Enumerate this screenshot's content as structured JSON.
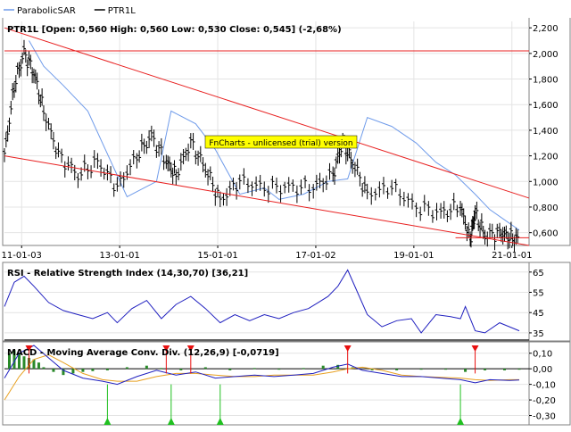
{
  "legend": {
    "items": [
      {
        "label": "ParabolicSAR",
        "color": "#6f9bea"
      },
      {
        "label": "PTR1L",
        "color": "#000000"
      }
    ]
  },
  "watermark": "FnCharts - unlicensed (trial) version",
  "colors": {
    "price": "#000000",
    "sar": "#6f9bea",
    "channel": "#e82020",
    "rsi": "#1f1fbf",
    "macd": "#1f1fbf",
    "signal": "#e8a020",
    "histogram": "#2a8a2a",
    "sell_arrow": "#e81010",
    "buy_arrow": "#20c020",
    "watermark_bg": "#ffff00"
  },
  "chart_data": [
    {
      "type": "line",
      "panel": "price",
      "title": "PTR1L [Open: 0,560  High: 0,560  Low: 0,530  Close: 0,545] (-2,68%)",
      "x": [
        "11-01-03",
        "13-01-01",
        "15-01-01",
        "17-01-02",
        "19-01-01",
        "21-01-01"
      ],
      "y_ticks": [
        "2,200",
        "2,000",
        "1,800",
        "1,600",
        "1,400",
        "1,200",
        "1,000",
        "0,800",
        "0,600"
      ],
      "y_tick_values": [
        2.2,
        2.0,
        1.8,
        1.6,
        1.4,
        1.2,
        1.0,
        0.8,
        0.6
      ],
      "ylim": [
        0.5,
        2.25
      ],
      "xlim": [
        2010.7,
        2021.4
      ],
      "series": [
        {
          "name": "PTR1L",
          "x": [
            2010.7,
            2010.9,
            2011.1,
            2011.3,
            2011.5,
            2011.8,
            2012.2,
            2012.6,
            2013.0,
            2013.4,
            2013.7,
            2014.0,
            2014.2,
            2014.5,
            2014.8,
            2015.1,
            2015.5,
            2016.0,
            2016.5,
            2017.0,
            2017.4,
            2017.6,
            2017.8,
            2018.1,
            2018.6,
            2019.1,
            2019.6,
            2020.0,
            2020.2,
            2020.3,
            2020.5,
            2020.8,
            2021.0,
            2021.2
          ],
          "values": [
            1.2,
            1.75,
            2.0,
            1.85,
            1.55,
            1.2,
            1.05,
            1.15,
            0.95,
            1.2,
            1.35,
            1.15,
            1.05,
            1.3,
            1.1,
            0.85,
            1.0,
            0.95,
            0.95,
            0.95,
            1.05,
            1.3,
            1.15,
            0.9,
            0.95,
            0.8,
            0.75,
            0.8,
            0.55,
            0.75,
            0.57,
            0.6,
            0.56,
            0.545
          ]
        },
        {
          "name": "ParabolicSAR",
          "x": [
            2011.2,
            2011.5,
            2011.9,
            2012.4,
            2013.2,
            2013.8,
            2014.1,
            2014.6,
            2015.0,
            2015.5,
            2016.0,
            2016.3,
            2016.8,
            2017.3,
            2017.7,
            2018.1,
            2018.6,
            2019.1,
            2019.5,
            2019.9,
            2020.3,
            2020.6,
            2020.9,
            2021.2
          ],
          "values": [
            2.1,
            1.9,
            1.75,
            1.55,
            0.88,
            1.0,
            1.55,
            1.45,
            1.25,
            0.9,
            0.95,
            0.86,
            0.9,
            1.0,
            1.02,
            1.5,
            1.43,
            1.3,
            1.15,
            1.05,
            0.9,
            0.78,
            0.7,
            0.62
          ]
        }
      ],
      "horizontal_lines": [
        2.02,
        0.56
      ],
      "channel_lines": [
        {
          "x": [
            2010.7,
            2021.4
          ],
          "values": [
            2.2,
            0.87
          ]
        },
        {
          "x": [
            2010.7,
            2021.4
          ],
          "values": [
            1.2,
            0.5
          ]
        }
      ],
      "grid": true
    },
    {
      "type": "line",
      "panel": "rsi",
      "title": "RSI - Relative Strength Index (14,30,70) [36,21]",
      "y_ticks": [
        "65",
        "55",
        "45",
        "35"
      ],
      "y_tick_values": [
        65,
        55,
        45,
        35
      ],
      "ylim": [
        31,
        68
      ],
      "xlim": [
        2010.7,
        2021.4
      ],
      "series": [
        {
          "name": "RSI",
          "x": [
            2010.7,
            2010.9,
            2011.1,
            2011.3,
            2011.6,
            2011.9,
            2012.2,
            2012.5,
            2012.8,
            2013.0,
            2013.3,
            2013.6,
            2013.9,
            2014.2,
            2014.5,
            2014.8,
            2015.1,
            2015.4,
            2015.7,
            2016.0,
            2016.3,
            2016.6,
            2016.9,
            2017.1,
            2017.3,
            2017.5,
            2017.7,
            2017.9,
            2018.1,
            2018.4,
            2018.7,
            2019.0,
            2019.2,
            2019.5,
            2019.8,
            2020.0,
            2020.1,
            2020.3,
            2020.5,
            2020.8,
            2021.0,
            2021.2
          ],
          "values": [
            48,
            60,
            63,
            58,
            50,
            46,
            44,
            42,
            45,
            40,
            47,
            51,
            42,
            49,
            53,
            47,
            40,
            44,
            41,
            44,
            42,
            45,
            47,
            50,
            53,
            58,
            66,
            55,
            44,
            38,
            41,
            42,
            35,
            44,
            43,
            42,
            48,
            36,
            35,
            40,
            38,
            36
          ]
        }
      ],
      "grid": true
    },
    {
      "type": "line",
      "panel": "macd",
      "title": "MACD - Moving Average Conv. Div. (12,26,9) [-0,0719]",
      "y_ticks": [
        "0,10",
        "0,00",
        "-0,10",
        "-0,20",
        "-0,30"
      ],
      "y_tick_values": [
        0.1,
        0.0,
        -0.1,
        -0.2,
        -0.3
      ],
      "ylim": [
        -0.36,
        0.15
      ],
      "xlim": [
        2010.7,
        2021.4
      ],
      "series": [
        {
          "name": "MACD",
          "x": [
            2010.7,
            2011.0,
            2011.3,
            2011.6,
            2011.9,
            2012.3,
            2012.7,
            2013.0,
            2013.4,
            2013.8,
            2014.2,
            2014.6,
            2015.0,
            2015.4,
            2015.8,
            2016.2,
            2016.6,
            2017.0,
            2017.4,
            2017.7,
            2018.0,
            2018.4,
            2018.8,
            2019.2,
            2019.6,
            2020.0,
            2020.3,
            2020.6,
            2021.0,
            2021.2
          ],
          "values": [
            -0.06,
            0.1,
            0.15,
            0.07,
            -0.01,
            -0.06,
            -0.08,
            -0.1,
            -0.05,
            -0.01,
            -0.04,
            -0.02,
            -0.06,
            -0.05,
            -0.04,
            -0.05,
            -0.04,
            -0.03,
            0.01,
            0.03,
            -0.01,
            -0.03,
            -0.05,
            -0.05,
            -0.06,
            -0.07,
            -0.09,
            -0.07,
            -0.075,
            -0.072
          ]
        },
        {
          "name": "Signal",
          "x": [
            2010.7,
            2011.0,
            2011.3,
            2011.6,
            2011.9,
            2012.3,
            2012.7,
            2013.0,
            2013.4,
            2013.8,
            2014.2,
            2014.6,
            2015.0,
            2015.4,
            2015.8,
            2016.2,
            2016.6,
            2017.0,
            2017.4,
            2017.7,
            2018.0,
            2018.4,
            2018.8,
            2019.2,
            2019.6,
            2020.0,
            2020.3,
            2020.6,
            2021.0,
            2021.2
          ],
          "values": [
            -0.2,
            -0.05,
            0.06,
            0.09,
            0.04,
            -0.03,
            -0.07,
            -0.08,
            -0.08,
            -0.05,
            -0.03,
            -0.03,
            -0.04,
            -0.05,
            -0.05,
            -0.04,
            -0.04,
            -0.04,
            -0.02,
            0.0,
            0.01,
            -0.01,
            -0.04,
            -0.05,
            -0.055,
            -0.06,
            -0.07,
            -0.075,
            -0.07,
            -0.07
          ]
        }
      ],
      "histogram": {
        "x": [
          2010.8,
          2010.9,
          2011.0,
          2011.1,
          2011.2,
          2011.3,
          2011.4,
          2011.5,
          2011.7,
          2011.9,
          2012.1,
          2012.3,
          2012.5,
          2012.8,
          2013.2,
          2013.6,
          2013.9,
          2014.3,
          2014.8,
          2015.3,
          2015.8,
          2016.3,
          2016.8,
          2017.2,
          2017.5,
          2017.8,
          2018.2,
          2018.7,
          2019.2,
          2019.7,
          2020.1,
          2020.5,
          2020.9,
          2021.2
        ],
        "values": [
          0.1,
          0.12,
          0.1,
          0.08,
          0.07,
          0.06,
          0.04,
          0.01,
          -0.02,
          -0.04,
          -0.03,
          -0.02,
          -0.015,
          -0.01,
          0.01,
          0.02,
          0.005,
          -0.01,
          0.01,
          -0.01,
          0.005,
          -0.005,
          0.005,
          0.02,
          0.025,
          0.01,
          -0.01,
          -0.01,
          -0.005,
          -0.005,
          -0.02,
          -0.01,
          -0.01,
          -0.002
        ]
      },
      "sell_signals": [
        2011.2,
        2014.0,
        2014.5,
        2017.7,
        2020.3
      ],
      "buy_signals": [
        2012.8,
        2014.1,
        2015.1,
        2020.0
      ],
      "grid": true
    }
  ]
}
